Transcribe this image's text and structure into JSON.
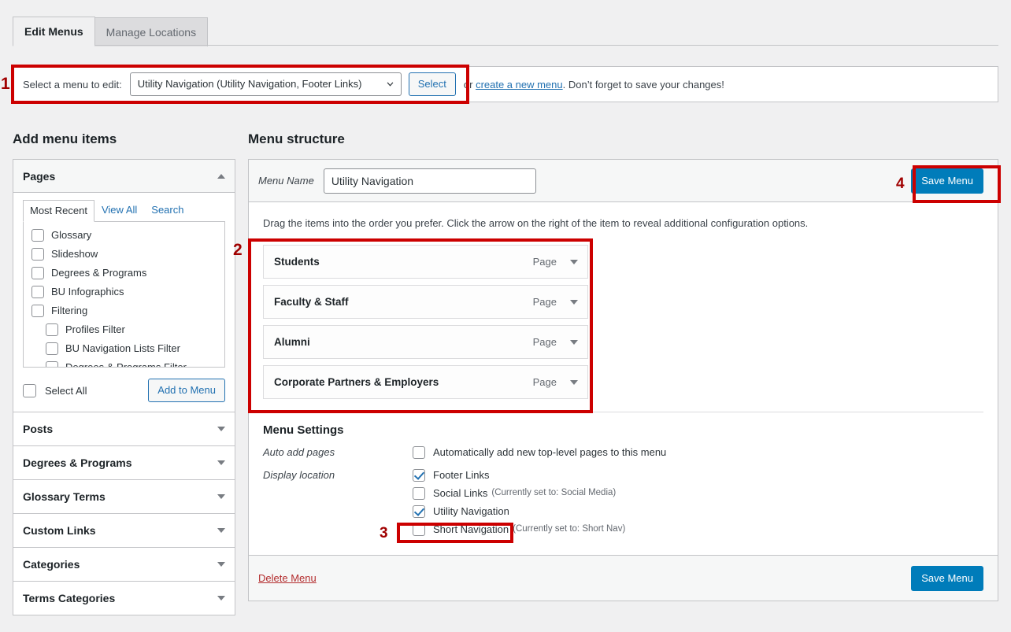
{
  "tabs": [
    {
      "label": "Edit Menus",
      "active": true
    },
    {
      "label": "Manage Locations",
      "active": false
    }
  ],
  "menu_select_bar": {
    "label": "Select a menu to edit:",
    "selected_option": "Utility Navigation (Utility Navigation, Footer Links)",
    "options": [
      "Utility Navigation (Utility Navigation, Footer Links)"
    ],
    "select_button": "Select",
    "tail_prefix": "or ",
    "tail_link": "create a new menu",
    "tail_suffix": ". Don’t forget to save your changes!"
  },
  "left_panel": {
    "title": "Add menu items",
    "pages_box": {
      "title": "Pages",
      "toggle_icon": "chevron-up-icon",
      "tabs": [
        {
          "label": "Most Recent",
          "active": true
        },
        {
          "label": "View All",
          "active": false
        },
        {
          "label": "Search",
          "active": false
        }
      ],
      "items": [
        {
          "label": "Glossary",
          "checked": false,
          "indent": false
        },
        {
          "label": "Slideshow",
          "checked": false,
          "indent": false
        },
        {
          "label": "Degrees & Programs",
          "checked": false,
          "indent": false
        },
        {
          "label": "BU Infographics",
          "checked": false,
          "indent": false
        },
        {
          "label": "Filtering",
          "checked": false,
          "indent": false
        },
        {
          "label": "Profiles Filter",
          "checked": false,
          "indent": true
        },
        {
          "label": "BU Navigation Lists Filter",
          "checked": false,
          "indent": true
        },
        {
          "label": "Degrees & Programs Filter",
          "checked": false,
          "indent": true
        }
      ],
      "select_all_label": "Select All",
      "select_all_checked": false,
      "add_button": "Add to Menu"
    },
    "collapsed_boxes": [
      {
        "title": "Posts",
        "toggle_icon": "chevron-down-icon"
      },
      {
        "title": "Degrees & Programs",
        "toggle_icon": "chevron-down-icon"
      },
      {
        "title": "Glossary Terms",
        "toggle_icon": "chevron-down-icon"
      },
      {
        "title": "Custom Links",
        "toggle_icon": "chevron-down-icon"
      },
      {
        "title": "Categories",
        "toggle_icon": "chevron-down-icon"
      },
      {
        "title": "Terms Categories",
        "toggle_icon": "chevron-down-icon"
      }
    ]
  },
  "right_panel": {
    "title": "Menu structure",
    "menu_name_label": "Menu Name",
    "menu_name_value": "Utility Navigation",
    "save_button_top": "Save Menu",
    "drag_hint": "Drag the items into the order you prefer. Click the arrow on the right of the item to reveal additional configuration options.",
    "menu_items": [
      {
        "title": "Students",
        "type": "Page",
        "arrow_icon": "chevron-down-icon"
      },
      {
        "title": "Faculty & Staff",
        "type": "Page",
        "arrow_icon": "chevron-down-icon"
      },
      {
        "title": "Alumni",
        "type": "Page",
        "arrow_icon": "chevron-down-icon"
      },
      {
        "title": "Corporate Partners & Employers",
        "type": "Page",
        "arrow_icon": "chevron-down-icon"
      }
    ],
    "settings": {
      "title": "Menu Settings",
      "auto_add_key": "Auto add pages",
      "auto_add_option": {
        "label": "Automatically add new top-level pages to this menu",
        "checked": false
      },
      "display_location_key": "Display location",
      "locations": [
        {
          "label": "Footer Links",
          "note": "",
          "checked": true
        },
        {
          "label": "Social Links",
          "note": "(Currently set to: Social Media)",
          "checked": false
        },
        {
          "label": "Utility Navigation",
          "note": "",
          "checked": true
        },
        {
          "label": "Short Navigation",
          "note": "(Currently set to: Short Nav)",
          "checked": false
        }
      ]
    },
    "delete_link": "Delete Menu",
    "save_button_bottom": "Save Menu"
  },
  "annotations": [
    {
      "number": "1"
    },
    {
      "number": "2"
    },
    {
      "number": "3"
    },
    {
      "number": "4"
    }
  ],
  "colors": {
    "annotation_red": "#cc0000",
    "annotation_number": "#a00000",
    "primary_button": "#007cba",
    "link_blue": "#2271b1",
    "delete_red": "#b32d2e",
    "page_bg": "#f0f0f1"
  }
}
